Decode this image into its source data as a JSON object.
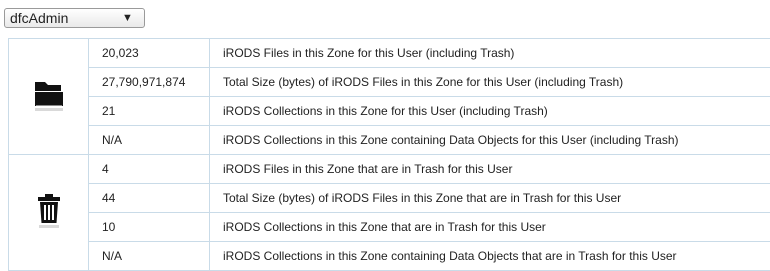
{
  "user_selector": {
    "selected": "dfcAdmin",
    "arrow": "▼"
  },
  "stats": {
    "files_group": {
      "icon": "folder-icon",
      "rows": [
        {
          "value": "20,023",
          "description": "iRODS Files in this Zone for this User (including Trash)"
        },
        {
          "value": "27,790,971,874",
          "description": "Total Size (bytes) of iRODS Files in this Zone for this User (including Trash)"
        },
        {
          "value": "21",
          "description": "iRODS Collections in this Zone for this User (including Trash)"
        },
        {
          "value": "N/A",
          "description": "iRODS Collections in this Zone containing Data Objects for this User (including Trash)"
        }
      ]
    },
    "trash_group": {
      "icon": "trash-icon",
      "rows": [
        {
          "value": "4",
          "description": "iRODS Files in this Zone that are in Trash for this User"
        },
        {
          "value": "44",
          "description": "Total Size (bytes) of iRODS Files in this Zone that are in Trash for this User"
        },
        {
          "value": "10",
          "description": "iRODS Collections in this Zone that are in Trash for this User"
        },
        {
          "value": "N/A",
          "description": "iRODS Collections in this Zone containing Data Objects that are in Trash for this User"
        }
      ]
    }
  }
}
